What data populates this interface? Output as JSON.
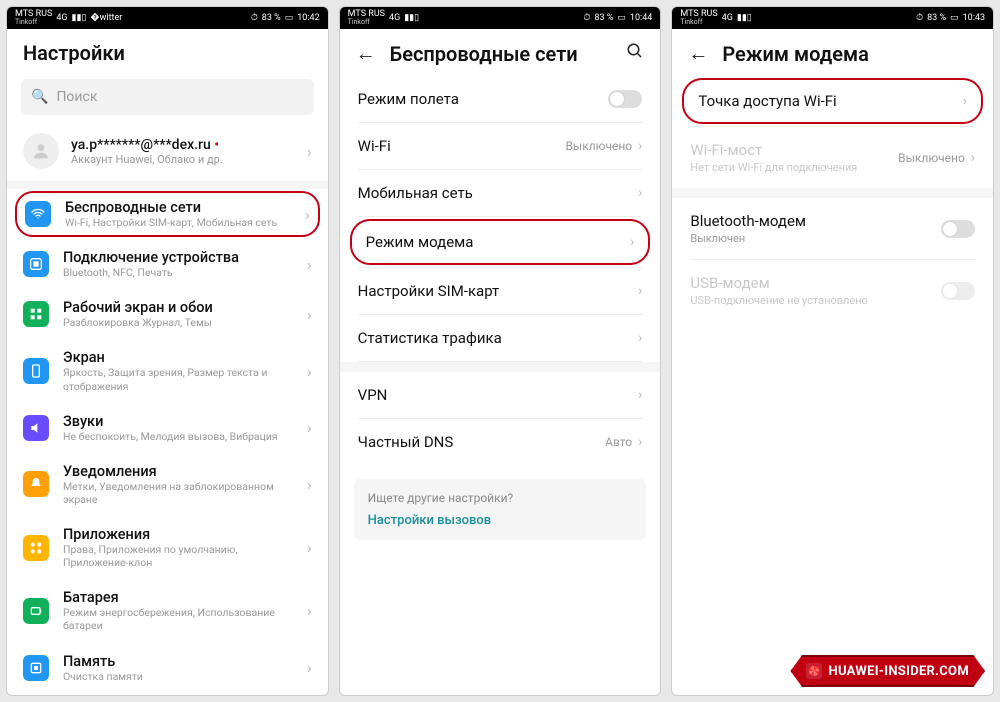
{
  "status": {
    "carrier_top": "MTS RUS",
    "carrier_sub": "Tinkoff",
    "lte": "4G",
    "batt": "83 %",
    "t1": "10:42",
    "t2": "10:44",
    "t3": "10:43",
    "alarm_icon": "⏱"
  },
  "s1": {
    "title": "Настройки",
    "search_ph": "Поиск",
    "account_email": "ya.p*******@***dex.ru",
    "account_sub": "Аккаунт Huawei, Облако и др.",
    "rows": [
      {
        "label": "Беспроводные сети",
        "sub": "Wi-Fi, Настройки SIM-карт, Мобильная сеть",
        "color": "#2196f3",
        "glyph": "wifi"
      },
      {
        "label": "Подключение устройства",
        "sub": "Bluetooth, NFC, Печать",
        "color": "#2196f3",
        "glyph": "link"
      },
      {
        "label": "Рабочий экран и обои",
        "sub": "Разблокировка Журнал, Темы",
        "color": "#11b05a",
        "glyph": "grid"
      },
      {
        "label": "Экран",
        "sub": "Яркость, Защита зрения, Размер текста и отображения",
        "color": "#2196f3",
        "glyph": "phone"
      },
      {
        "label": "Звуки",
        "sub": "Не беспокоить, Мелодия вызова, Вибрация",
        "color": "#6a4cff",
        "glyph": "sound"
      },
      {
        "label": "Уведомления",
        "sub": "Метки, Уведомления на заблокированном экране",
        "color": "#ff9f0a",
        "glyph": "bell"
      },
      {
        "label": "Приложения",
        "sub": "Права, Приложения по умолчанию, Приложение-клон",
        "color": "#ffb400",
        "glyph": "apps"
      },
      {
        "label": "Батарея",
        "sub": "Режим энергосбережения, Использование батареи",
        "color": "#11b05a",
        "glyph": "batt"
      },
      {
        "label": "Память",
        "sub": "Очистка памяти",
        "color": "#2196f3",
        "glyph": "mem"
      }
    ]
  },
  "s2": {
    "title": "Беспроводные сети",
    "rows": [
      {
        "label": "Режим полета",
        "type": "toggle"
      },
      {
        "label": "Wi-Fi",
        "type": "value",
        "val": "Выключено"
      },
      {
        "label": "Мобильная сеть",
        "type": "chev"
      },
      {
        "label": "Режим модема",
        "type": "chev",
        "hl": true
      },
      {
        "label": "Настройки SIM-карт",
        "type": "chev"
      },
      {
        "label": "Статистика трафика",
        "type": "chev"
      },
      {
        "label": "VPN",
        "type": "chev"
      },
      {
        "label": "Частный DNS",
        "type": "value",
        "val": "Авто"
      }
    ],
    "footer_q": "Ищете другие настройки?",
    "footer_link": "Настройки вызовов"
  },
  "s3": {
    "title": "Режим модема",
    "rows": [
      {
        "label": "Точка доступа Wi-Fi",
        "type": "chev",
        "hl": true
      },
      {
        "label": "Wi-Fi-мост",
        "sub": "Нет сети Wi-Fi для подключения",
        "type": "value",
        "val": "Выключено",
        "disabled": true
      },
      {
        "label": "Bluetooth-модем",
        "sub": "Выключен",
        "type": "toggle"
      },
      {
        "label": "USB-модем",
        "sub": "USB-подключение не установлено",
        "type": "toggle",
        "disabled": true
      }
    ]
  },
  "watermark": "HUAWEI-INSIDER.COM"
}
